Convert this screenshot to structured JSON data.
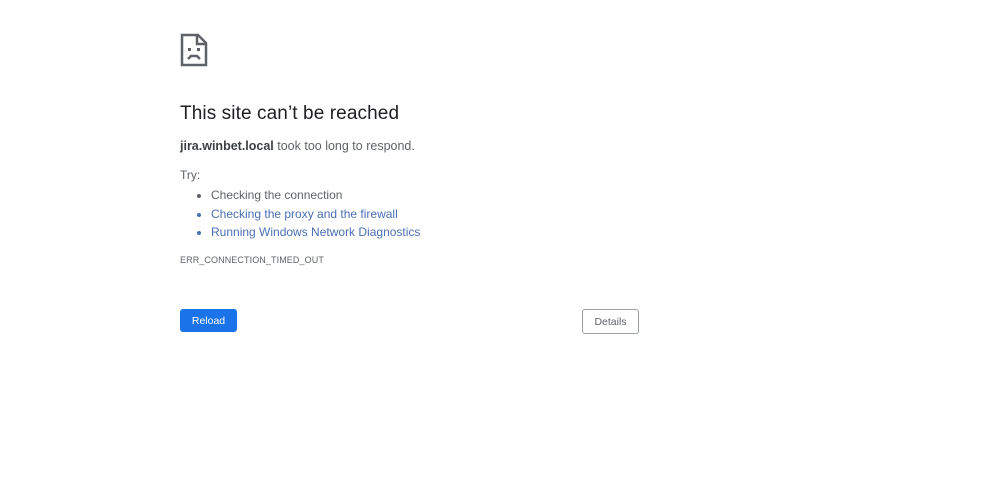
{
  "error_page": {
    "icon": "sad-page-icon",
    "heading": "This site can’t be reached",
    "summary": {
      "host": "jira.winbet.local",
      "message": " took too long to respond."
    },
    "try_label": "Try:",
    "suggestions": [
      {
        "label": "Checking the connection",
        "is_link": false
      },
      {
        "label": "Checking the proxy and the firewall",
        "is_link": true
      },
      {
        "label": "Running Windows Network Diagnostics",
        "is_link": true
      }
    ],
    "error_code": "ERR_CONNECTION_TIMED_OUT"
  },
  "buttons": {
    "reload_label": "Reload",
    "details_label": "Details"
  },
  "colors": {
    "primary_button": "#1a73e8",
    "link": "#4a6fb3",
    "text_secondary": "#5f6368"
  }
}
